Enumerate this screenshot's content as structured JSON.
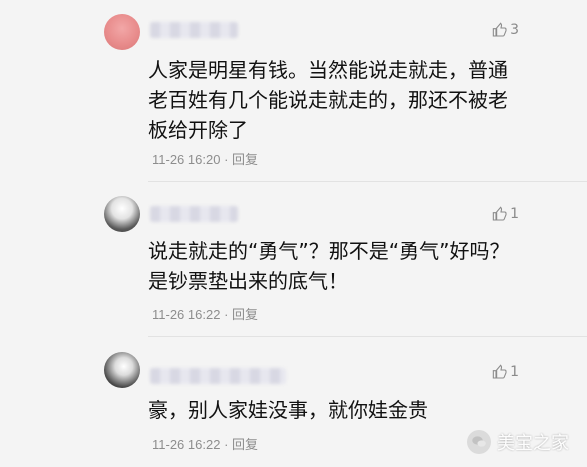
{
  "comments": [
    {
      "text": "人家是明星有钱。当然能说走就走，普通老百姓有几个能说走就走的，那还不被老板给开除了",
      "date": "11-26 16:20",
      "reply": "回复",
      "likes": "3"
    },
    {
      "text": "说走就走的“勇气”？那不是“勇气”好吗？是钞票垫出来的底气！",
      "date": "11-26 16:22",
      "reply": "回复",
      "likes": "1"
    },
    {
      "text": "豪，别人家娃没事，就你娃金贵",
      "date": "11-26 16:22",
      "reply": "回复",
      "likes": "1"
    }
  ],
  "watermark": {
    "text": "美宝之家"
  },
  "colors": {
    "background": "#f4f4f4",
    "text": "#111111",
    "meta": "#8d8d8d"
  }
}
